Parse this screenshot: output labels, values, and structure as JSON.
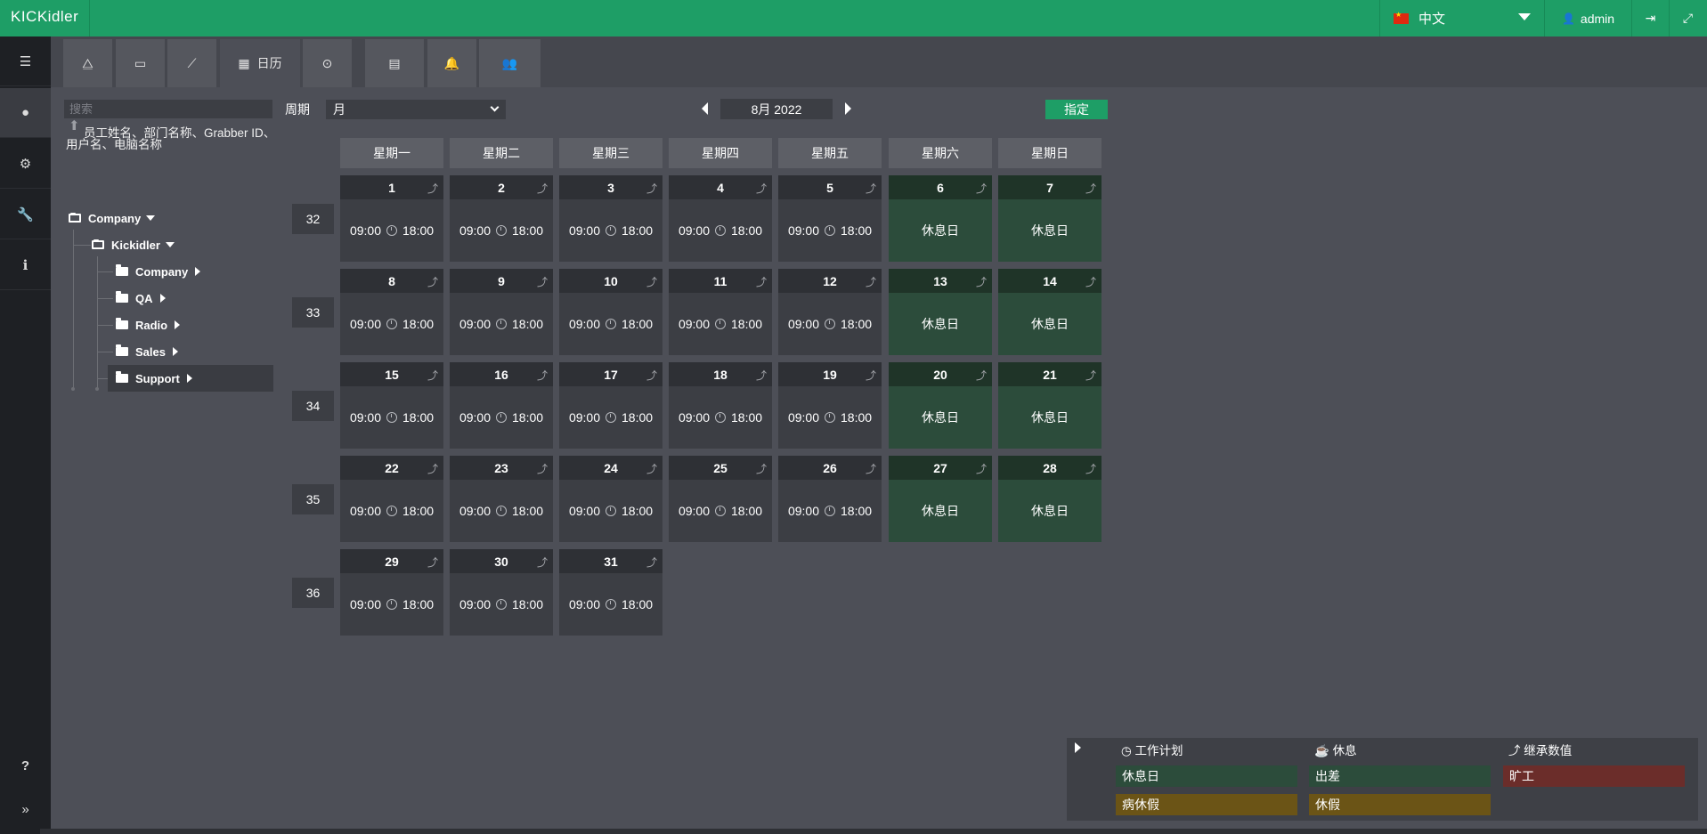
{
  "app": {
    "logo": "KICKidler"
  },
  "topbar": {
    "language": "中文",
    "user": "admin"
  },
  "sidebar": {
    "items": [
      "list-icon",
      "user-icon",
      "cogs-icon",
      "wrench-icon",
      "info-icon"
    ],
    "bottom": [
      "question-icon",
      "expand-icon"
    ]
  },
  "tabs": [
    {
      "icon": "org-structure-icon",
      "label": ""
    },
    {
      "icon": "monitor-icon",
      "label": ""
    },
    {
      "icon": "chart-icon",
      "label": ""
    },
    {
      "icon": "calendar-icon",
      "label": "日历"
    },
    {
      "icon": "toggle-icon",
      "label": ""
    },
    {
      "icon": "id-card-icon",
      "label": ""
    },
    {
      "icon": "bell-icon",
      "label": ""
    },
    {
      "icon": "users-icon",
      "label": ""
    }
  ],
  "search": {
    "placeholder": "搜索",
    "hint": "员工姓名、部门名称、Grabber ID、用户名、电脑名称"
  },
  "tree": {
    "root": "Company",
    "child": "Kickidler",
    "departments": [
      "Company",
      "QA",
      "Radio",
      "Sales",
      "Support"
    ]
  },
  "toolbar": {
    "period_label": "周期",
    "period_value": "月",
    "month": "8月 2022",
    "assign": "指定"
  },
  "calendar": {
    "weekdays": [
      "星期一",
      "星期二",
      "星期三",
      "星期四",
      "星期五",
      "星期六",
      "星期日"
    ],
    "weeks": [
      "32",
      "33",
      "34",
      "35",
      "36"
    ],
    "work_start": "09:00",
    "work_end": "18:00",
    "day_off_label": "休息日",
    "inherit_icon": "⤴",
    "days": [
      {
        "d": "1",
        "off": false
      },
      {
        "d": "2",
        "off": false
      },
      {
        "d": "3",
        "off": false
      },
      {
        "d": "4",
        "off": false
      },
      {
        "d": "5",
        "off": false
      },
      {
        "d": "6",
        "off": true
      },
      {
        "d": "7",
        "off": true
      },
      {
        "d": "8",
        "off": false
      },
      {
        "d": "9",
        "off": false
      },
      {
        "d": "10",
        "off": false
      },
      {
        "d": "11",
        "off": false
      },
      {
        "d": "12",
        "off": false
      },
      {
        "d": "13",
        "off": true
      },
      {
        "d": "14",
        "off": true
      },
      {
        "d": "15",
        "off": false
      },
      {
        "d": "16",
        "off": false
      },
      {
        "d": "17",
        "off": false
      },
      {
        "d": "18",
        "off": false
      },
      {
        "d": "19",
        "off": false
      },
      {
        "d": "20",
        "off": true
      },
      {
        "d": "21",
        "off": true
      },
      {
        "d": "22",
        "off": false
      },
      {
        "d": "23",
        "off": false
      },
      {
        "d": "24",
        "off": false
      },
      {
        "d": "25",
        "off": false
      },
      {
        "d": "26",
        "off": false
      },
      {
        "d": "27",
        "off": true
      },
      {
        "d": "28",
        "off": true
      },
      {
        "d": "29",
        "off": false
      },
      {
        "d": "30",
        "off": false
      },
      {
        "d": "31",
        "off": false
      }
    ]
  },
  "legend": {
    "work_plan": "工作计划",
    "rest": "休息",
    "inherited": "继承数值",
    "items": [
      {
        "label": "休息日",
        "color": "#2c4c3b"
      },
      {
        "label": "出差",
        "color": "#2c4c3b"
      },
      {
        "label": "旷工",
        "color": "#6b2d2a"
      },
      {
        "label": "病休假",
        "color": "#6b5416"
      },
      {
        "label": "休假",
        "color": "#6b5416"
      }
    ]
  }
}
